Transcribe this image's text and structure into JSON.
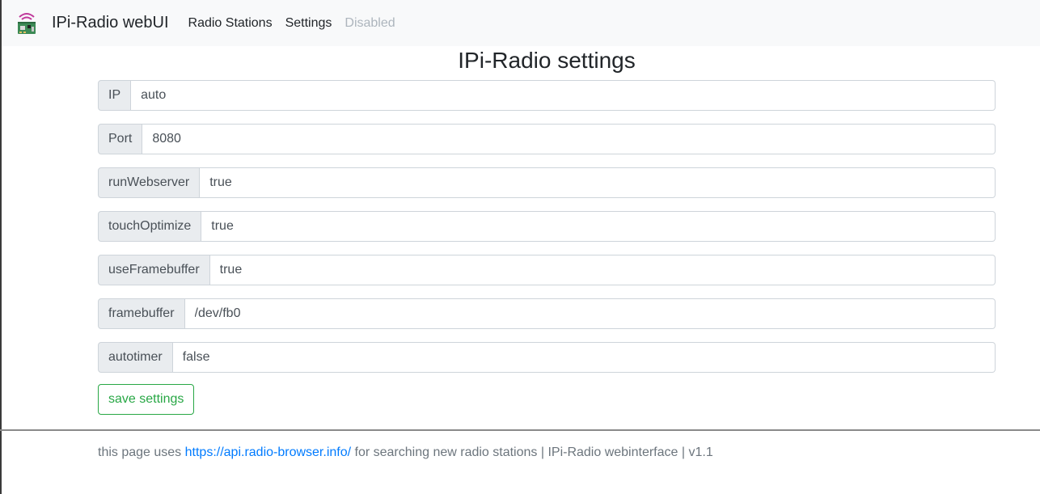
{
  "navbar": {
    "brand": "IPi-Radio webUI",
    "links": [
      {
        "label": "Radio Stations",
        "disabled": false
      },
      {
        "label": "Settings",
        "disabled": false
      },
      {
        "label": "Disabled",
        "disabled": true
      }
    ]
  },
  "page": {
    "title": "IPi-Radio settings"
  },
  "settings": [
    {
      "label": "IP",
      "value": "auto"
    },
    {
      "label": "Port",
      "value": "8080"
    },
    {
      "label": "runWebserver",
      "value": "true"
    },
    {
      "label": "touchOptimize",
      "value": "true"
    },
    {
      "label": "useFramebuffer",
      "value": "true"
    },
    {
      "label": "framebuffer",
      "value": "/dev/fb0"
    },
    {
      "label": "autotimer",
      "value": "false"
    }
  ],
  "form": {
    "save_label": "save settings"
  },
  "footer": {
    "prefix": "this page uses ",
    "link": "https://api.radio-browser.info/",
    "suffix": " for searching new radio stations | IPi-Radio webinterface | v1.1"
  },
  "colors": {
    "navbar_bg": "#f8f9fa",
    "addon_bg": "#e9ecef",
    "success": "#28a745",
    "link": "#007bff",
    "muted": "#6c757d"
  }
}
